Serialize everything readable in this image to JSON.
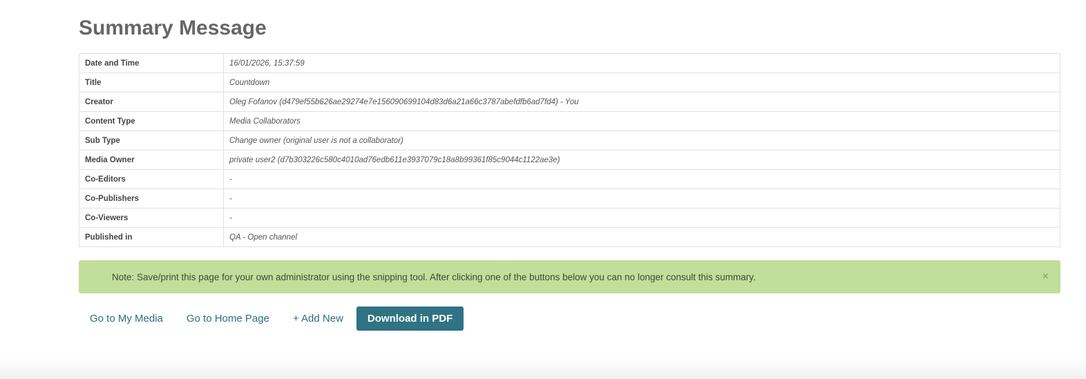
{
  "page_title": "Summary Message",
  "summary_rows": [
    {
      "label": "Date and Time",
      "value": "16/01/2026, 15:37:59"
    },
    {
      "label": "Title",
      "value": "Countdown"
    },
    {
      "label": "Creator",
      "value": "Oleg Fofanov (d479ef55b626ae29274e7e156090699104d83d6a21a66c3787abefdfb6ad7fd4) - You"
    },
    {
      "label": "Content Type",
      "value": "Media Collaborators"
    },
    {
      "label": "Sub Type",
      "value": "Change owner (original user is not a collaborator)"
    },
    {
      "label": "Media Owner",
      "value": "private user2 (d7b303226c580c4010ad76edb611e3937079c18a8b99361f85c9044c1122ae3e)"
    },
    {
      "label": "Co-Editors",
      "value": "-"
    },
    {
      "label": "Co-Publishers",
      "value": "-"
    },
    {
      "label": "Co-Viewers",
      "value": "-"
    },
    {
      "label": "Published in",
      "value": "QA - Open channel"
    }
  ],
  "note": {
    "text": "Note: Save/print this page for your own administrator using the snipping tool. After clicking one of the buttons below you can no longer consult this summary.",
    "close_label": "×"
  },
  "actions": {
    "my_media": "Go to My Media",
    "home_page": "Go to Home Page",
    "add_new": "+ Add New",
    "download_pdf": "Download in PDF"
  },
  "colors": {
    "note_background": "#c2de9b",
    "link": "#2e6b82",
    "primary_button": "#2f7384"
  }
}
